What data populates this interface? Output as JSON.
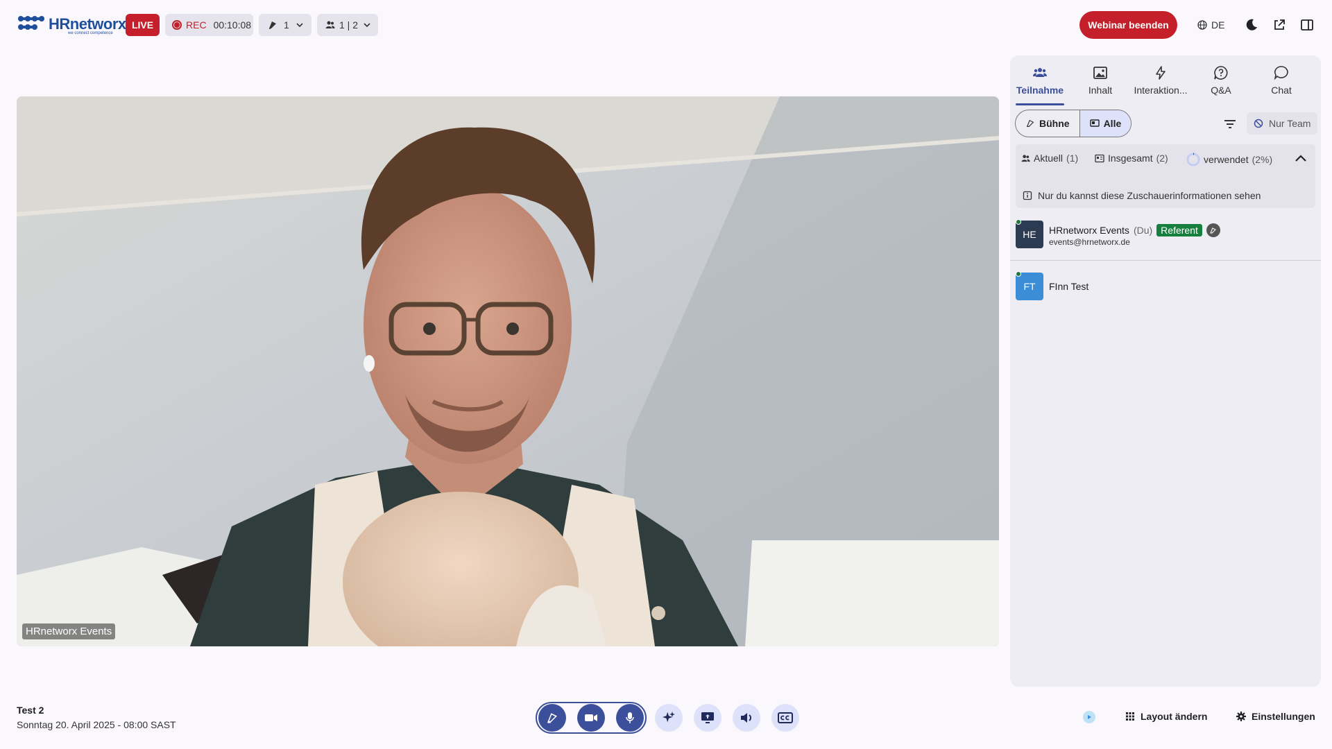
{
  "topbar": {
    "logo_text": "HRnetworx",
    "logo_tagline": "we connect competence",
    "live_label": "LIVE",
    "rec_label": "REC",
    "rec_time": "00:10:08",
    "stage_count": "1",
    "participants_count": "1 | 2",
    "end_button": "Webinar beenden",
    "language": "DE"
  },
  "video": {
    "name_tag": "HRnetworx Events"
  },
  "panel": {
    "tabs": [
      {
        "label": "Teilnahme",
        "icon": "people-icon",
        "active": true
      },
      {
        "label": "Inhalt",
        "icon": "image-icon",
        "active": false
      },
      {
        "label": "Interaktion...",
        "icon": "lightning-icon",
        "active": false
      },
      {
        "label": "Q&A",
        "icon": "question-bubble-icon",
        "active": false
      },
      {
        "label": "Chat",
        "icon": "chat-bubble-icon",
        "active": false
      }
    ],
    "segment": {
      "stage": "Bühne",
      "all": "Alle"
    },
    "nur_team": "Nur Team",
    "stats": {
      "current": "Aktuell",
      "current_count": "(1)",
      "total": "Insgesamt",
      "total_count": "(2)",
      "used": "verwendet",
      "used_pct": "(2%)",
      "used_fraction": 0.02
    },
    "info_text": "Nur du kannst diese Zuschauerinformationen sehen",
    "participants": [
      {
        "initials": "HE",
        "name": "HRnetworx Events",
        "you": "(Du)",
        "role": "Referent",
        "email": "events@hrnetworx.de",
        "color": "#2d3b52"
      },
      {
        "initials": "FT",
        "name": "FInn Test",
        "color": "#3a8dd6"
      }
    ]
  },
  "bottom": {
    "event_title": "Test 2",
    "event_date": "Sonntag 20. April 2025 - 08:00 SAST",
    "layout_label": "Layout ändern",
    "settings_label": "Einstellungen"
  },
  "colors": {
    "accent": "#3b4f9b",
    "live_red": "#c41f2a",
    "referent_green": "#15803d"
  }
}
